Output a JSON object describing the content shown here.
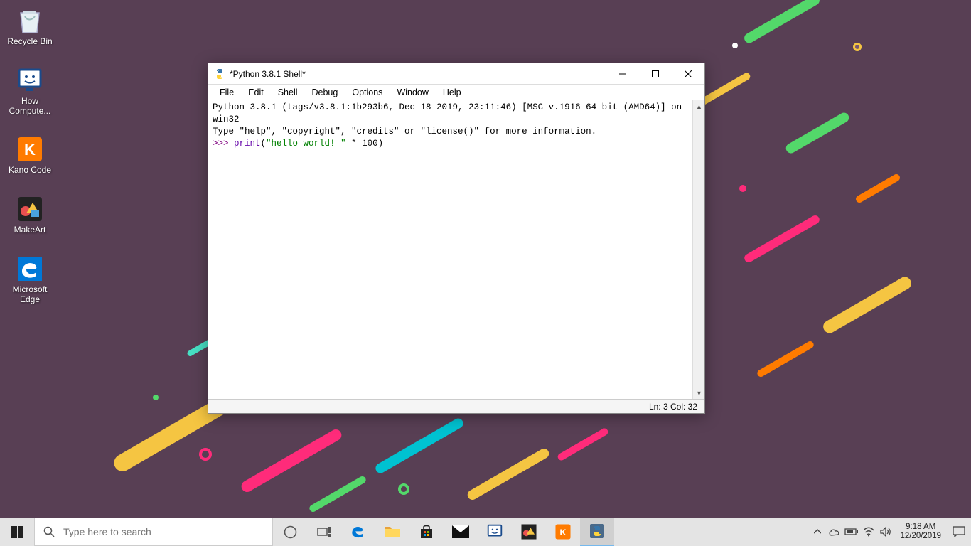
{
  "desktop_icons": [
    {
      "name": "recycle-bin",
      "label": "Recycle Bin"
    },
    {
      "name": "how-computers",
      "label": "How\nCompute..."
    },
    {
      "name": "kano-code",
      "label": "Kano Code"
    },
    {
      "name": "make-art",
      "label": "MakeArt"
    },
    {
      "name": "ms-edge",
      "label": "Microsoft\nEdge"
    }
  ],
  "window": {
    "title": "*Python 3.8.1 Shell*",
    "menus": [
      "File",
      "Edit",
      "Shell",
      "Debug",
      "Options",
      "Window",
      "Help"
    ],
    "shell": {
      "banner_line1": "Python 3.8.1 (tags/v3.8.1:1b293b6, Dec 18 2019, 23:11:46) [MSC v.1916 64 bit (AMD64)] on win32",
      "banner_line2": "Type \"help\", \"copyright\", \"credits\" or \"license()\" for more information.",
      "prompt": ">>> ",
      "func": "print",
      "open": "(",
      "string": "\"hello world! \"",
      "rest": " * 100)"
    },
    "status": "Ln: 3  Col: 32"
  },
  "taskbar": {
    "search_placeholder": "Type here to search",
    "time": "9:18 AM",
    "date": "12/20/2019"
  }
}
